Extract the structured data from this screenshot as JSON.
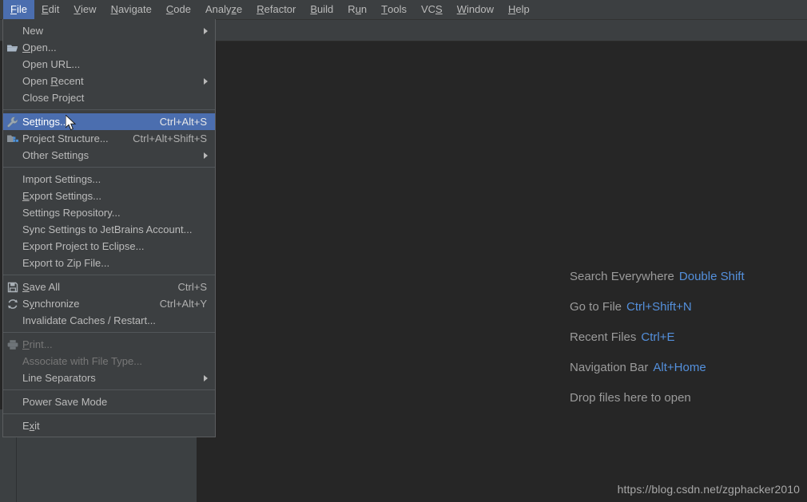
{
  "menubar": {
    "items": [
      {
        "label": "File",
        "mnemonic": "F",
        "active": true
      },
      {
        "label": "Edit",
        "mnemonic": "E",
        "active": false
      },
      {
        "label": "View",
        "mnemonic": "V",
        "active": false
      },
      {
        "label": "Navigate",
        "mnemonic": "N",
        "active": false
      },
      {
        "label": "Code",
        "mnemonic": "C",
        "active": false
      },
      {
        "label": "Analyze",
        "mnemonic": "z",
        "active": false
      },
      {
        "label": "Refactor",
        "mnemonic": "R",
        "active": false
      },
      {
        "label": "Build",
        "mnemonic": "B",
        "active": false
      },
      {
        "label": "Run",
        "mnemonic": "u",
        "active": false
      },
      {
        "label": "Tools",
        "mnemonic": "T",
        "active": false
      },
      {
        "label": "VCS",
        "mnemonic": "S",
        "active": false
      },
      {
        "label": "Window",
        "mnemonic": "W",
        "active": false
      },
      {
        "label": "Help",
        "mnemonic": "H",
        "active": false
      }
    ]
  },
  "file_menu": {
    "items": [
      {
        "label": "New",
        "accel": "",
        "icon": "",
        "submenu": true,
        "selected": false,
        "disabled": false
      },
      {
        "label": "Open...",
        "accel": "",
        "icon": "folder-open-icon",
        "submenu": false,
        "selected": false,
        "disabled": false,
        "mnemonic": "O"
      },
      {
        "label": "Open URL...",
        "accel": "",
        "icon": "",
        "submenu": false,
        "selected": false,
        "disabled": false
      },
      {
        "label": "Open Recent",
        "accel": "",
        "icon": "",
        "submenu": true,
        "selected": false,
        "disabled": false,
        "mnemonic": "R"
      },
      {
        "label": "Close Project",
        "accel": "",
        "icon": "",
        "submenu": false,
        "selected": false,
        "disabled": false
      },
      {
        "separator": true
      },
      {
        "label": "Settings...",
        "accel": "Ctrl+Alt+S",
        "icon": "wrench-icon",
        "submenu": false,
        "selected": true,
        "disabled": false,
        "mnemonic": "t"
      },
      {
        "label": "Project Structure...",
        "accel": "Ctrl+Alt+Shift+S",
        "icon": "project-structure-icon",
        "submenu": false,
        "selected": false,
        "disabled": false
      },
      {
        "label": "Other Settings",
        "accel": "",
        "icon": "",
        "submenu": true,
        "selected": false,
        "disabled": false
      },
      {
        "separator": true
      },
      {
        "label": "Import Settings...",
        "accel": "",
        "icon": "",
        "submenu": false,
        "selected": false,
        "disabled": false
      },
      {
        "label": "Export Settings...",
        "accel": "",
        "icon": "",
        "submenu": false,
        "selected": false,
        "disabled": false,
        "mnemonic": "E"
      },
      {
        "label": "Settings Repository...",
        "accel": "",
        "icon": "",
        "submenu": false,
        "selected": false,
        "disabled": false
      },
      {
        "label": "Sync Settings to JetBrains Account...",
        "accel": "",
        "icon": "",
        "submenu": false,
        "selected": false,
        "disabled": false
      },
      {
        "label": "Export Project to Eclipse...",
        "accel": "",
        "icon": "",
        "submenu": false,
        "selected": false,
        "disabled": false
      },
      {
        "label": "Export to Zip File...",
        "accel": "",
        "icon": "",
        "submenu": false,
        "selected": false,
        "disabled": false
      },
      {
        "separator": true
      },
      {
        "label": "Save All",
        "accel": "Ctrl+S",
        "icon": "save-icon",
        "submenu": false,
        "selected": false,
        "disabled": false,
        "mnemonic": "S"
      },
      {
        "label": "Synchronize",
        "accel": "Ctrl+Alt+Y",
        "icon": "synchronize-icon",
        "submenu": false,
        "selected": false,
        "disabled": false,
        "mnemonic": "y"
      },
      {
        "label": "Invalidate Caches / Restart...",
        "accel": "",
        "icon": "",
        "submenu": false,
        "selected": false,
        "disabled": false
      },
      {
        "separator": true
      },
      {
        "label": "Print...",
        "accel": "",
        "icon": "printer-icon",
        "submenu": false,
        "selected": false,
        "disabled": true,
        "mnemonic": "P"
      },
      {
        "label": "Associate with File Type...",
        "accel": "",
        "icon": "",
        "submenu": false,
        "selected": false,
        "disabled": true
      },
      {
        "label": "Line Separators",
        "accel": "",
        "icon": "",
        "submenu": true,
        "selected": false,
        "disabled": false
      },
      {
        "separator": true
      },
      {
        "label": "Power Save Mode",
        "accel": "",
        "icon": "",
        "submenu": false,
        "selected": false,
        "disabled": false
      },
      {
        "separator": true
      },
      {
        "label": "Exit",
        "accel": "",
        "icon": "",
        "submenu": false,
        "selected": false,
        "disabled": false,
        "mnemonic": "x"
      }
    ]
  },
  "editor_empty_state": {
    "shortcuts": [
      {
        "label": "Search Everywhere",
        "key": "Double Shift"
      },
      {
        "label": "Go to File",
        "key": "Ctrl+Shift+N"
      },
      {
        "label": "Recent Files",
        "key": "Ctrl+E"
      },
      {
        "label": "Navigation Bar",
        "key": "Alt+Home"
      },
      {
        "label": "Drop files here to open",
        "key": ""
      }
    ]
  },
  "watermark": {
    "text": "https://blog.csdn.net/zgphacker2010"
  },
  "colors": {
    "menu_bg": "#3c3f41",
    "editor_bg": "#262626",
    "selection_blue": "#4b6eaf",
    "accent_link": "#5490dc",
    "text": "#bbbbbb",
    "text_disabled": "#777777"
  }
}
